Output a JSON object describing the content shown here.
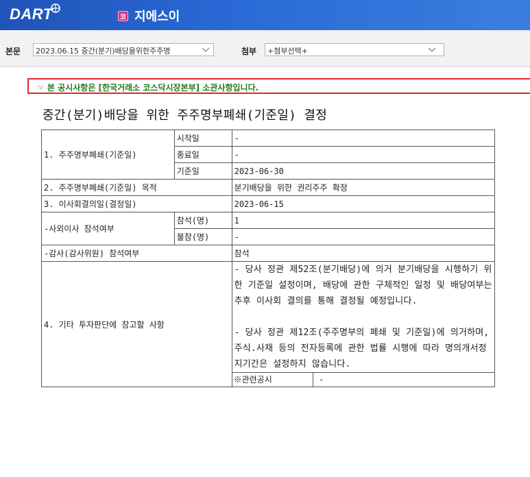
{
  "header": {
    "logo_text": "DART",
    "corp_badge": "코",
    "corp_name": "지에스이"
  },
  "toolbar": {
    "body_label": "본문",
    "body_select_value": "2023.06.15  중간(분기)배당을위한주주명",
    "attach_label": "첨부",
    "attach_select_value": "+첨부선택+"
  },
  "notice": "☞ 본 공시사항은 [한국거래소 코스닥시장본부] 소관사항입니다.",
  "doc_title": "중간(분기)배당을 위한 주주명부폐쇄(기준일) 결정",
  "table": {
    "row1": {
      "label": "1. 주주명부폐쇄(기준일)",
      "start_label": "시작일",
      "start_value": "-",
      "end_label": "종료일",
      "end_value": "-",
      "record_label": "기준일",
      "record_value": "2023-06-30"
    },
    "row2": {
      "label": "2. 주주명부폐쇄(기준일) 목적",
      "value": "분기배당을 위한 권리주주 확정"
    },
    "row3": {
      "label": "3. 이사회결의일(결정일)",
      "value": "2023-06-15"
    },
    "row4": {
      "label": "-사외이사 참석여부",
      "present_label": "참석(명)",
      "present_value": "1",
      "absent_label": "불참(명)",
      "absent_value": "-"
    },
    "row5": {
      "label": "-감사(감사위원) 참석여부",
      "value": "참석"
    },
    "row6": {
      "label": "4. 기타 투자판단에 참고할 사항",
      "paragraph1": "- 당사 정관 제52조(분기배당)에 의거 분기배당을 시행하기 위한 기준일 설정이며, 배당에 관한 구체적인 일정 및 배당여부는 추후 이사회 결의를 통해 결정될 예정입니다.",
      "paragraph2": "- 당사 정관 제12조(주주명부의 폐쇄 및 기준일)에 의거하며, 주식.사채 등의 전자등록에 관한 법률 시행에 따라 명의개서정지기간은 설정하지 않습니다.",
      "related_label": "※관련공시",
      "related_value": "-"
    }
  },
  "colors": {
    "header_blue": "#2a6ad6",
    "notice_border": "#e02525",
    "notice_text": "#1e7a1e",
    "badge_pink": "#d9308c"
  }
}
